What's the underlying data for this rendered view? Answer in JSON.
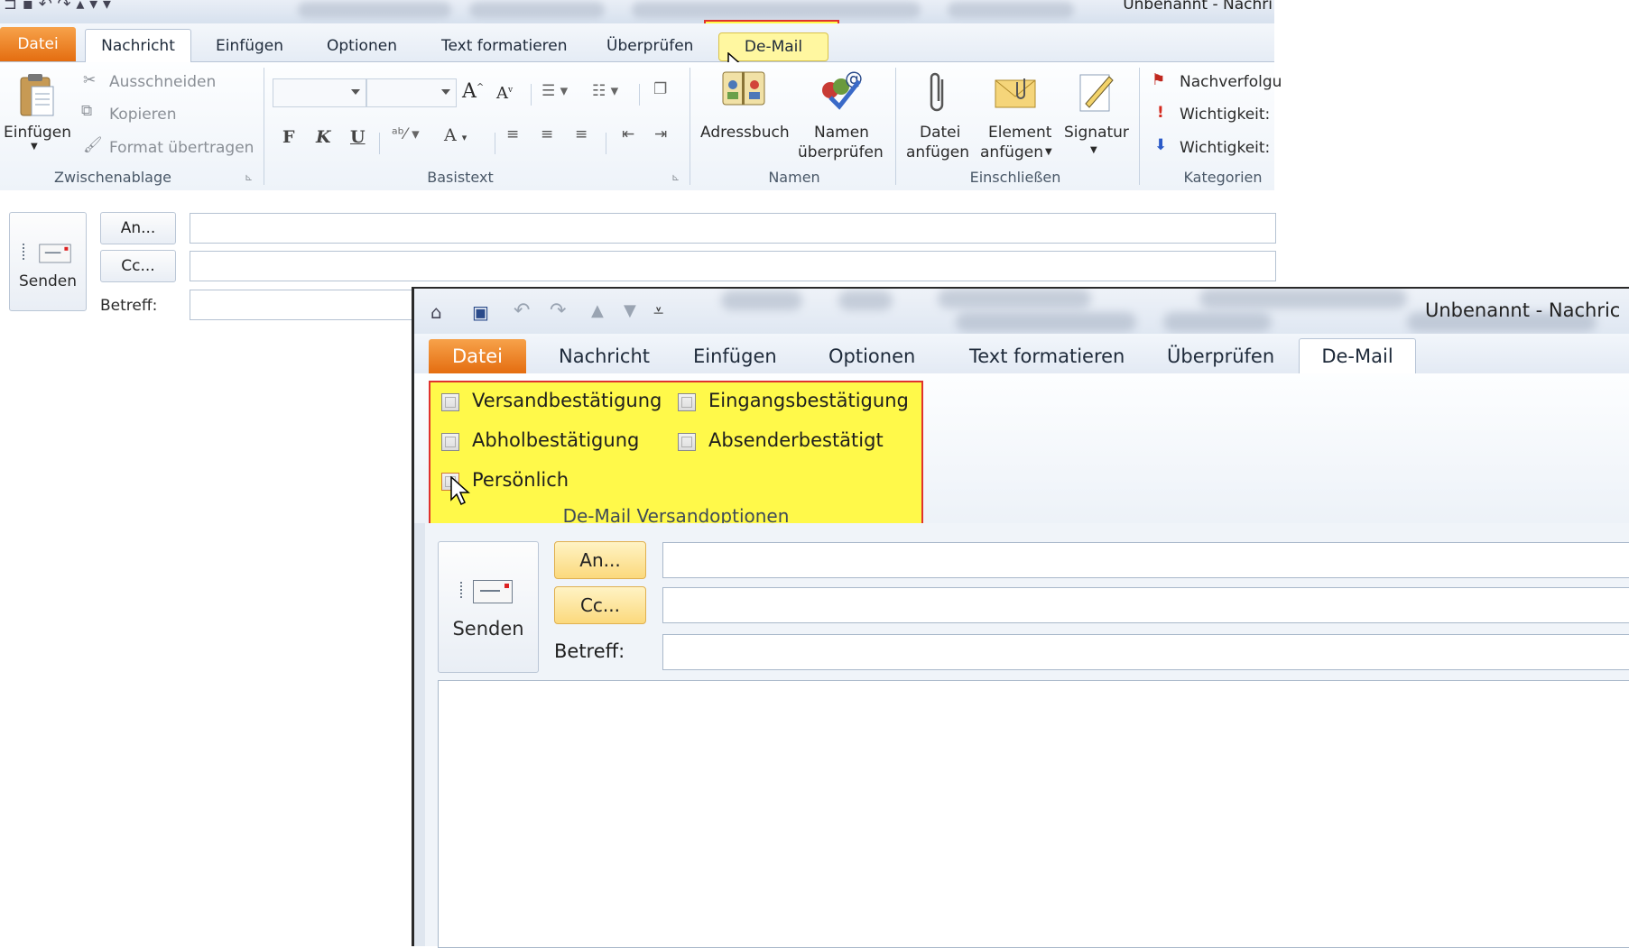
{
  "back_window": {
    "title": "Unbenannt - Nachri",
    "tabs": [
      "Datei",
      "Nachricht",
      "Einfügen",
      "Optionen",
      "Text formatieren",
      "Überprüfen",
      "De-Mail"
    ],
    "clipboard": {
      "paste": "Einfügen",
      "cut": "Ausschneiden",
      "copy": "Kopieren",
      "format_painter": "Format übertragen",
      "group": "Zwischenablage"
    },
    "basic_text": {
      "group": "Basistext",
      "bold": "F",
      "italic": "K",
      "underline": "U"
    },
    "names": {
      "address_book": "Adressbuch",
      "check_names_1": "Namen",
      "check_names_2": "überprüfen",
      "group": "Namen"
    },
    "include": {
      "attach_file_1": "Datei",
      "attach_file_2": "anfügen",
      "attach_item_1": "Element",
      "attach_item_2": "anfügen",
      "signature": "Signatur",
      "group": "Einschließen"
    },
    "tags": {
      "follow_up": "Nachverfolgu",
      "high_importance": "Wichtigkeit:",
      "low_importance": "Wichtigkeit:",
      "group": "Kategorien"
    },
    "form": {
      "send": "Senden",
      "to": "An...",
      "cc": "Cc...",
      "subject": "Betreff:"
    }
  },
  "front_window": {
    "title": "Unbenannt - Nachric",
    "tabs": [
      "Datei",
      "Nachricht",
      "Einfügen",
      "Optionen",
      "Text formatieren",
      "Überprüfen",
      "De-Mail"
    ],
    "demail_options": {
      "group": "De-Mail Versandoptionen",
      "versandbestaetigung": "Versandbestätigung",
      "eingangsbestaetigung": "Eingangsbestätigung",
      "abholbestaetigung": "Abholbestätigung",
      "absenderbestaetigt": "Absenderbestätigt",
      "persoenlich": "Persönlich"
    },
    "form": {
      "send": "Senden",
      "to": "An...",
      "cc": "Cc...",
      "subject": "Betreff:"
    }
  },
  "colors": {
    "highlight": "#fff94a",
    "highlight_border": "#e0322d",
    "datei_tab": "#e46d10"
  }
}
